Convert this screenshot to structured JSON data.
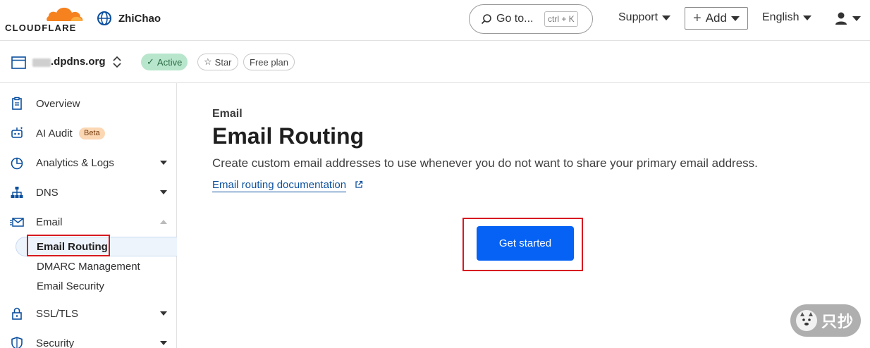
{
  "header": {
    "brand": "CLOUDFLARE",
    "account_name": "ZhiChao",
    "search_label": "Go to...",
    "search_shortcut": "ctrl + K",
    "support_label": "Support",
    "add_label": "Add",
    "language_label": "English"
  },
  "zone": {
    "name": ".dpdns.org",
    "status": "Active",
    "star_label": "Star",
    "plan": "Free plan"
  },
  "sidebar": {
    "items": [
      {
        "label": "Overview",
        "icon": "clipboard-icon"
      },
      {
        "label": "AI Audit",
        "icon": "robot-icon",
        "badge": "Beta"
      },
      {
        "label": "Analytics & Logs",
        "icon": "pie-chart-icon"
      },
      {
        "label": "DNS",
        "icon": "network-icon"
      },
      {
        "label": "Email",
        "icon": "envelope-icon"
      },
      {
        "label": "SSL/TLS",
        "icon": "lock-icon"
      },
      {
        "label": "Security",
        "icon": "shield-icon"
      }
    ],
    "email_sub": [
      "Email Routing",
      "DMARC Management",
      "Email Security"
    ]
  },
  "main": {
    "eyebrow": "Email",
    "title": "Email Routing",
    "description": "Create custom email addresses to use whenever you do not want to share your primary email address.",
    "doc_link": "Email routing documentation",
    "cta": "Get started"
  },
  "watermark": "只抄",
  "colors": {
    "accent": "#0562f5",
    "brand_orange": "#f6821f",
    "highlight": "#d71920"
  }
}
